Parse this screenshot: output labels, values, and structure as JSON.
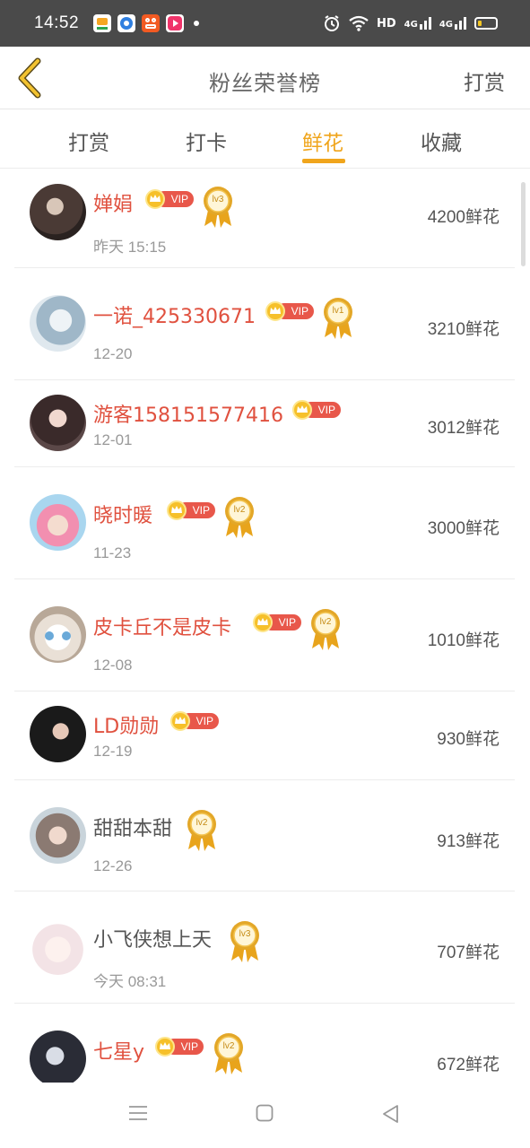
{
  "status_bar": {
    "time": "14:52",
    "network_hd": "HD",
    "network_4g_1": "4G",
    "network_4g_2": "4G",
    "icons": [
      "alarm-icon",
      "wifi-icon",
      "signal-icon",
      "battery-icon"
    ],
    "battery_level": 0.2
  },
  "header": {
    "title": "粉丝荣誉榜",
    "right_action": "打赏",
    "back_icon": "chevron-left-icon"
  },
  "tabs": [
    {
      "label": "打赏",
      "active": false
    },
    {
      "label": "打卡",
      "active": false
    },
    {
      "label": "鲜花",
      "active": true
    },
    {
      "label": "收藏",
      "active": false
    }
  ],
  "ranking": [
    {
      "name": "婵娟",
      "date": "昨天 15:15",
      "amount": "4200鲜花",
      "vip": true,
      "level": "lv3",
      "name_color": "red"
    },
    {
      "name": "一诺_425330671",
      "date": "12-20",
      "amount": "3210鲜花",
      "vip": true,
      "level": "lv1",
      "name_color": "red"
    },
    {
      "name": "游客158151577416",
      "date": "12-01",
      "amount": "3012鲜花",
      "vip": true,
      "level": "",
      "name_color": "red"
    },
    {
      "name": "晓时暖",
      "date": "11-23",
      "amount": "3000鲜花",
      "vip": true,
      "level": "lv2",
      "name_color": "red"
    },
    {
      "name": "皮卡丘不是皮卡",
      "date": "12-08",
      "amount": "1010鲜花",
      "vip": true,
      "level": "lv2",
      "name_color": "red"
    },
    {
      "name": "LD勋勋",
      "date": "12-19",
      "amount": "930鲜花",
      "vip": true,
      "level": "",
      "name_color": "red"
    },
    {
      "name": "甜甜本甜",
      "date": "12-26",
      "amount": "913鲜花",
      "vip": false,
      "level": "lv2",
      "name_color": "gray"
    },
    {
      "name": "小飞侠想上天",
      "date": "今天 08:31",
      "amount": "707鲜花",
      "vip": false,
      "level": "lv3",
      "name_color": "gray"
    },
    {
      "name": "七星y",
      "date": "",
      "amount": "672鲜花",
      "vip": true,
      "level": "lv2",
      "name_color": "red"
    }
  ],
  "vip_label": "VIP",
  "colors": {
    "accent": "#f0a51c",
    "vip_red": "#e8574a",
    "name_red": "#e0513f",
    "status_bar": "#4a4a4a"
  },
  "nav_bar": {
    "icons": [
      "menu-icon",
      "home-icon",
      "back-icon"
    ]
  }
}
